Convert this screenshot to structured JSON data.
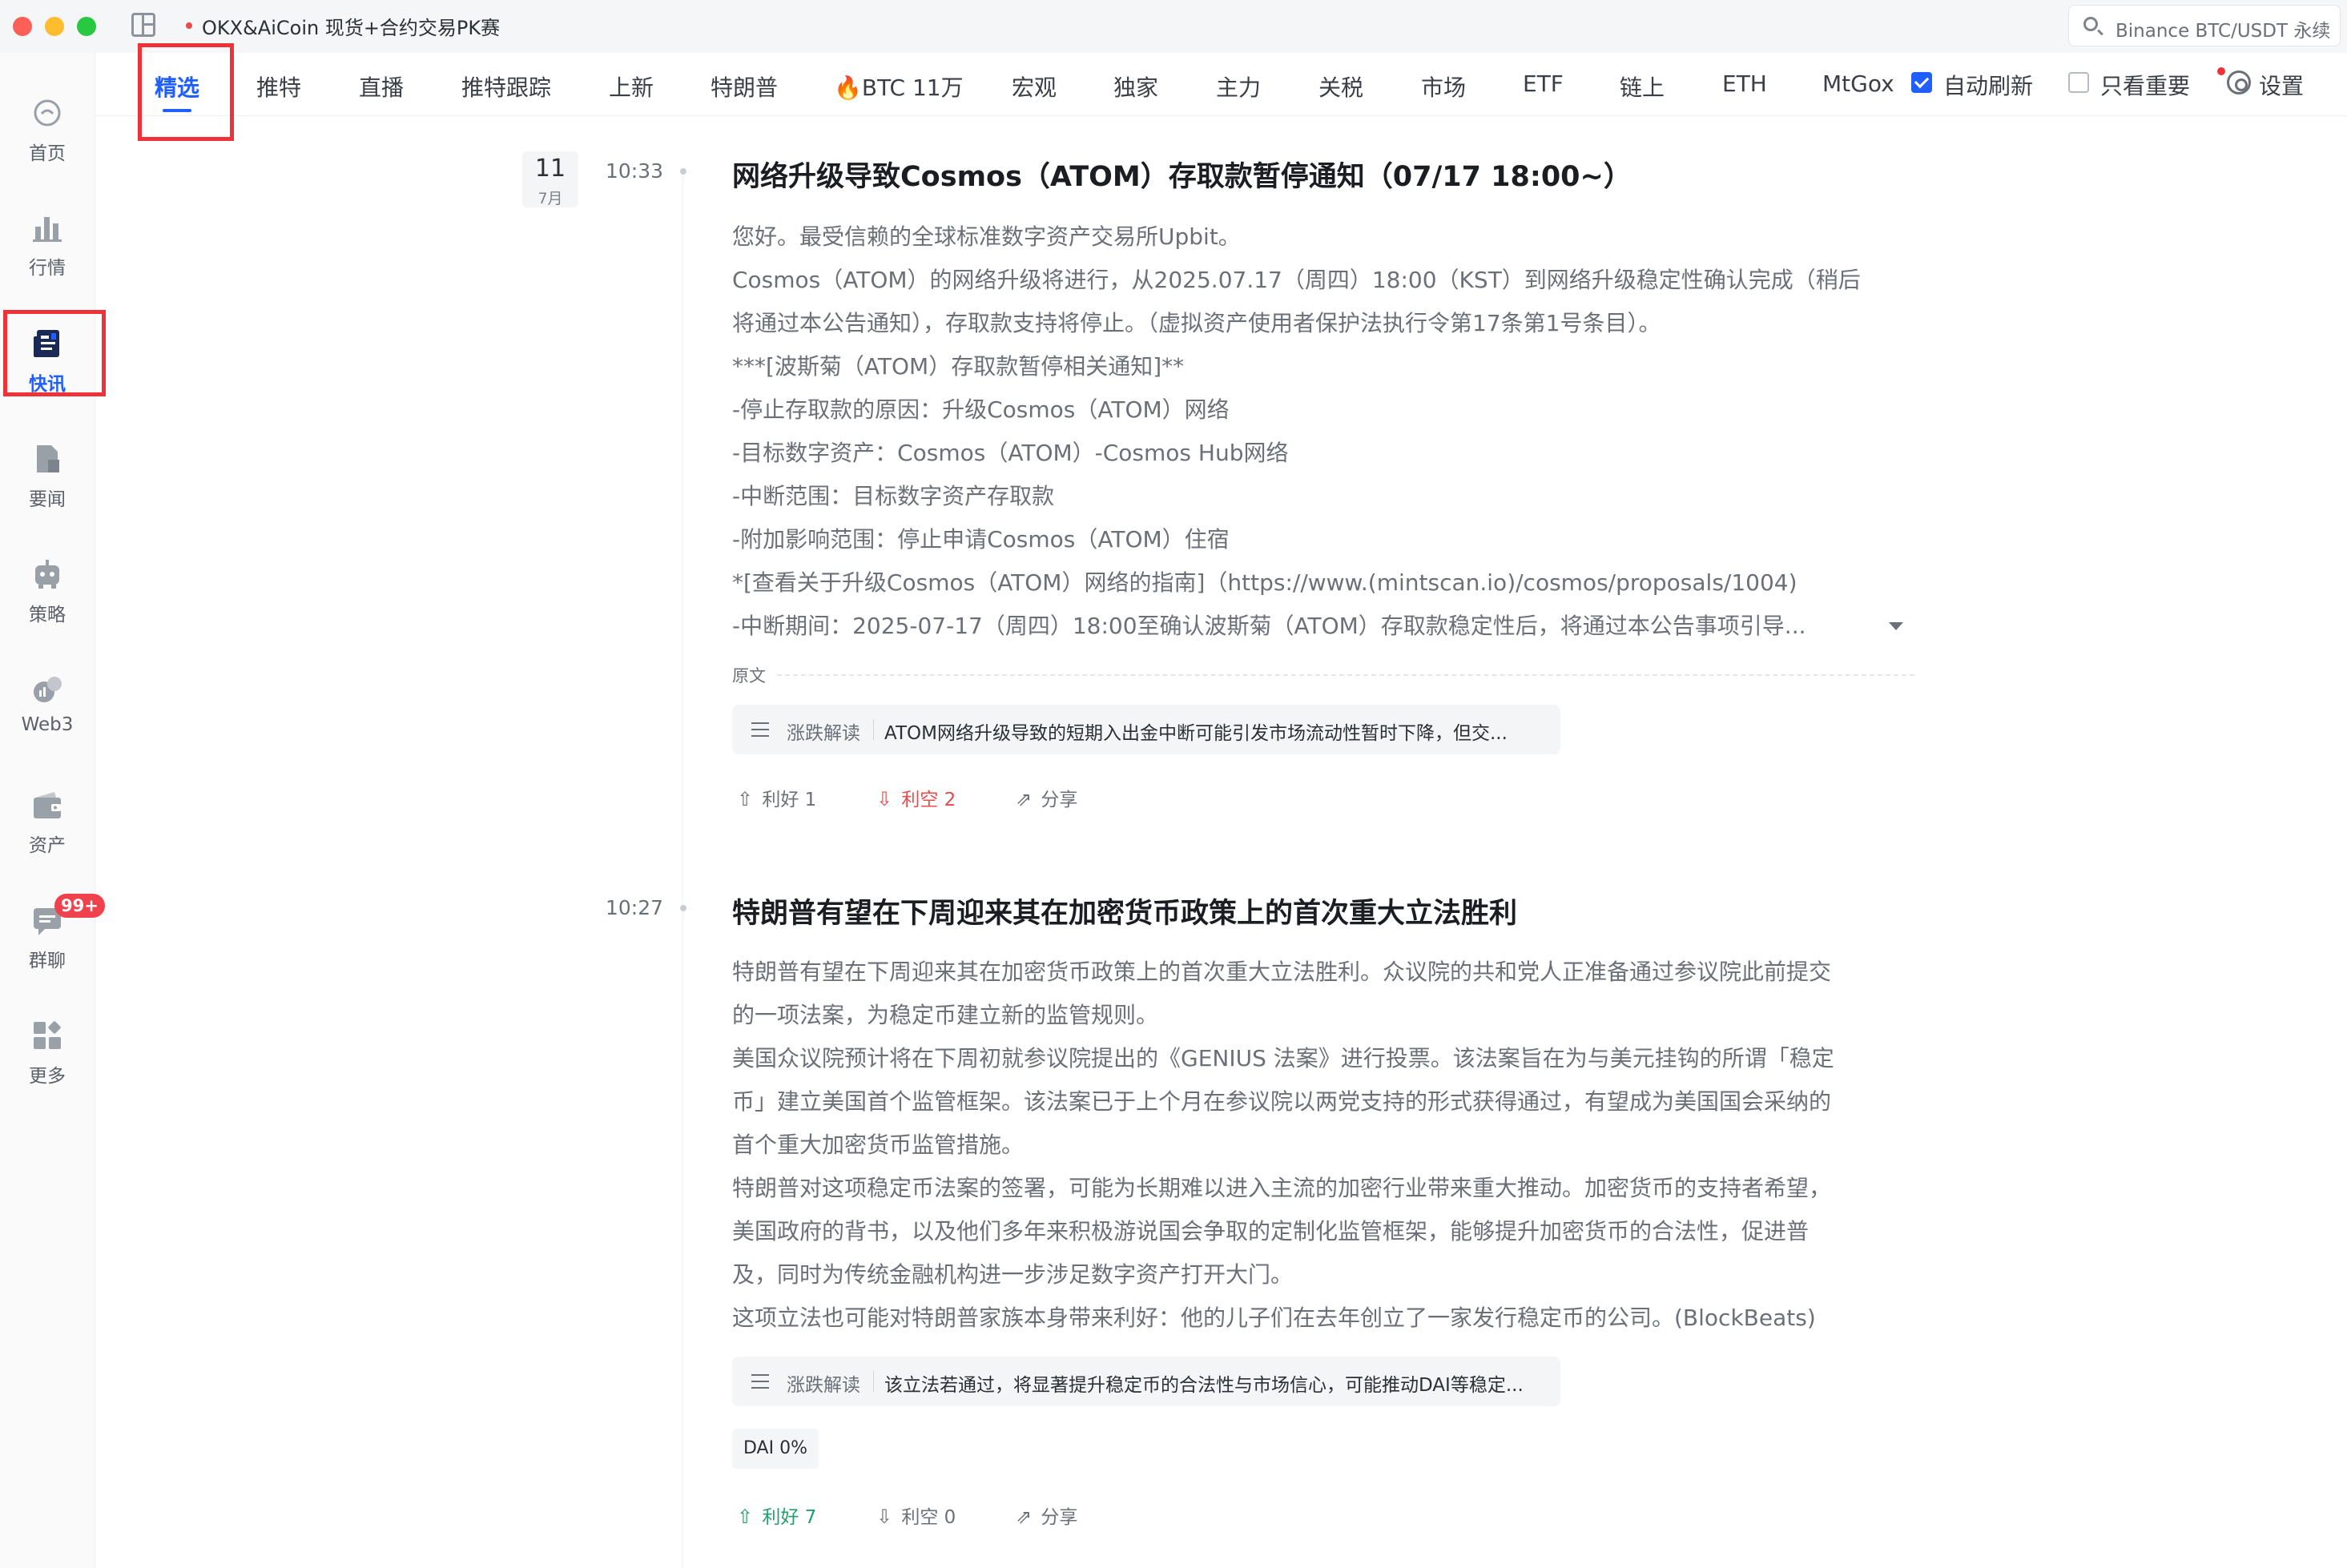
{
  "window": {
    "title": "OKX&AiCoin 现货+合约交易PK赛",
    "search_text": "Binance BTC/USDT 永续"
  },
  "sidebar": {
    "items": [
      {
        "label": "首页",
        "icon": "home-icon"
      },
      {
        "label": "行情",
        "icon": "chart-bars-icon"
      },
      {
        "label": "快讯",
        "icon": "newsflash-icon",
        "active": true
      },
      {
        "label": "要闻",
        "icon": "news-doc-icon"
      },
      {
        "label": "策略",
        "icon": "robot-icon"
      },
      {
        "label": "Web3",
        "icon": "web3-icon"
      },
      {
        "label": "资产",
        "icon": "wallet-icon"
      },
      {
        "label": "群聊",
        "icon": "chat-icon",
        "badge": "99+"
      },
      {
        "label": "更多",
        "icon": "grid-more-icon"
      }
    ]
  },
  "tabs": [
    {
      "label": "精选",
      "active": true
    },
    {
      "label": "推特"
    },
    {
      "label": "直播"
    },
    {
      "label": "推特跟踪"
    },
    {
      "label": "上新"
    },
    {
      "label": "特朗普"
    },
    {
      "label": "🔥BTC 11万"
    },
    {
      "label": "宏观"
    },
    {
      "label": "独家"
    },
    {
      "label": "主力"
    },
    {
      "label": "关税"
    },
    {
      "label": "市场"
    },
    {
      "label": "ETF"
    },
    {
      "label": "链上"
    },
    {
      "label": "ETH"
    },
    {
      "label": "MtGox"
    }
  ],
  "filters": {
    "auto_refresh": {
      "label": "自动刷新",
      "checked": true
    },
    "important_only": {
      "label": "只看重要",
      "checked": false
    },
    "settings_label": "设置"
  },
  "date": {
    "day": "11",
    "month": "7月"
  },
  "news": [
    {
      "time": "10:33",
      "title": "网络升级导致Cosmos（ATOM）存取款暂停通知（07/17 18:00~）",
      "lines": [
        "您好。最受信赖的全球标准数字资产交易所Upbit。",
        "Cosmos（ATOM）的网络升级将进行，从2025.07.17（周四）18:00（KST）到网络升级稳定性确认完成（稍后",
        "将通过本公告通知），存取款支持将停止。（虚拟资产使用者保护法执行令第17条第1号条目）。",
        "***[波斯菊（ATOM）存取款暂停相关通知]**",
        "-停止存取款的原因：升级Cosmos（ATOM）网络",
        "-目标数字资产：Cosmos（ATOM）-Cosmos Hub网络",
        "-中断范围：目标数字资产存取款",
        "-附加影响范围：停止申请Cosmos（ATOM）住宿",
        "*[查看关于升级Cosmos（ATOM）网络的指南]（https://www.(mintscan.io)/cosmos/proposals/1004)",
        "-中断期间：2025-07-17（周四）18:00至确认波斯菊（ATOM）存取款稳定性后，将通过本公告事项引导..."
      ],
      "original_label": "原文",
      "ai_label": "涨跌解读",
      "ai_text": "ATOM网络升级导致的短期入出金中断可能引发市场流动性暂时下降，但交...",
      "bullish": "利好 1",
      "bearish": "利空 2",
      "share": "分享"
    },
    {
      "time": "10:27",
      "title": "特朗普有望在下周迎来其在加密货币政策上的首次重大立法胜利",
      "lines": [
        "特朗普有望在下周迎来其在加密货币政策上的首次重大立法胜利。众议院的共和党人正准备通过参议院此前提交",
        "的一项法案，为稳定币建立新的监管规则。",
        "美国众议院预计将在下周初就参议院提出的《GENIUS 法案》进行投票。该法案旨在为与美元挂钩的所谓「稳定",
        "币」建立美国首个监管框架。该法案已于上个月在参议院以两党支持的形式获得通过，有望成为美国国会采纳的",
        "首个重大加密货币监管措施。",
        "特朗普对这项稳定币法案的签署，可能为长期难以进入主流的加密行业带来重大推动。加密货币的支持者希望，",
        "美国政府的背书，以及他们多年来积极游说国会争取的定制化监管框架，能够提升加密货币的合法性，促进普",
        "及，同时为传统金融机构进一步涉足数字资产打开大门。",
        "这项立法也可能对特朗普家族本身带来利好：他的儿子们在去年创立了一家发行稳定币的公司。(BlockBeats)"
      ],
      "ai_label": "涨跌解读",
      "ai_text": "该立法若通过，将显著提升稳定币的合法性与市场信心，可能推动DAI等稳定...",
      "coin_tag": "DAI 0%",
      "bullish": "利好 7",
      "bearish": "利空 0",
      "share": "分享"
    }
  ]
}
